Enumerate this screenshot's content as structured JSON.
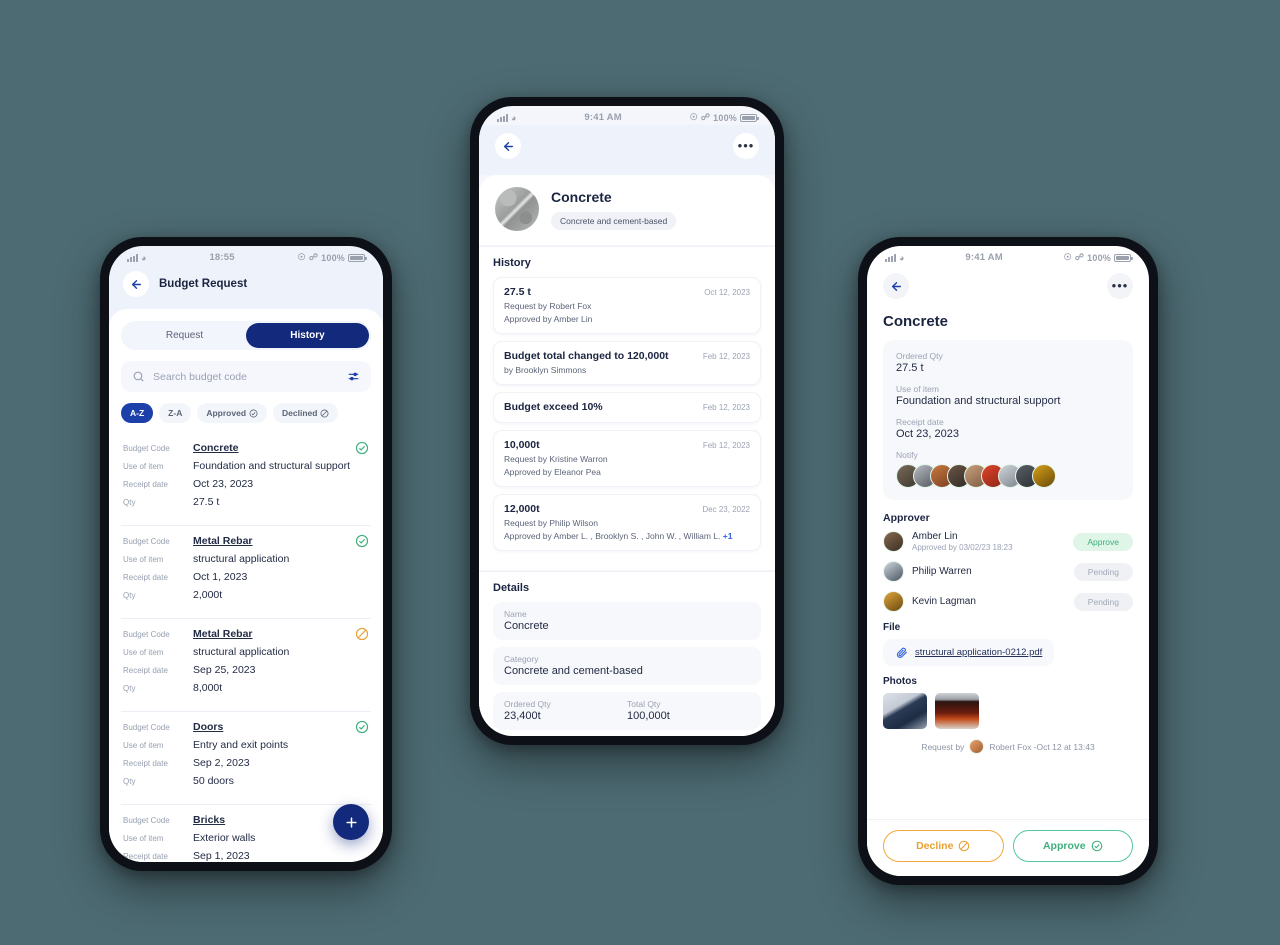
{
  "theme": {
    "background": "#4d6b73",
    "navy": "#12297c",
    "blue": "#1c3faa",
    "green": "#3fae7c",
    "orange": "#e8a033"
  },
  "left_phone": {
    "status": {
      "time": "18:55",
      "battery": "100%"
    },
    "header": {
      "title": "Budget Request",
      "back_icon": "arrow-left-icon"
    },
    "tabs": [
      {
        "label": "Request",
        "active": false
      },
      {
        "label": "History",
        "active": true
      }
    ],
    "search": {
      "placeholder": "Search budget code",
      "value": "",
      "icon": "search-icon",
      "filter_icon": "filter-icon"
    },
    "chips": [
      {
        "label": "A-Z",
        "active": true,
        "icon": ""
      },
      {
        "label": "Z-A",
        "active": false,
        "icon": ""
      },
      {
        "label": "Approved",
        "active": false,
        "icon": "check-circle-icon"
      },
      {
        "label": "Declined",
        "active": false,
        "icon": "ban-circle-icon"
      }
    ],
    "field_labels": {
      "code": "Budget Code",
      "use": "Use of item",
      "receipt": "Receipt date",
      "qty": "Qty"
    },
    "records": [
      {
        "code": "Concrete",
        "use": "Foundation and structural support",
        "receipt": "Oct 23, 2023",
        "qty": "27.5 t",
        "status": "approved"
      },
      {
        "code": "Metal Rebar",
        "use": "structural application",
        "receipt": "Oct 1, 2023",
        "qty": "2,000t",
        "status": "approved"
      },
      {
        "code": "Metal Rebar",
        "use": "structural application",
        "receipt": "Sep 25, 2023",
        "qty": "8,000t",
        "status": "declined"
      },
      {
        "code": "Doors",
        "use": "Entry and exit points",
        "receipt": "Sep 2, 2023",
        "qty": "50 doors",
        "status": "approved"
      },
      {
        "code": "Bricks",
        "use": "Exterior walls",
        "receipt": "Sep 1, 2023",
        "qty": "",
        "status": "approved"
      }
    ],
    "fab": {
      "label": "+",
      "icon": "plus-icon"
    }
  },
  "center_phone": {
    "status": {
      "time": "9:41 AM",
      "battery": "100%"
    },
    "topbar": {
      "back_icon": "arrow-left-icon",
      "menu_icon": "more-horizontal-icon"
    },
    "hero": {
      "name": "Concrete",
      "tag": "Concrete and cement-based",
      "thumb_icon": "concrete-thumbnail"
    },
    "history": {
      "title": "History",
      "items": [
        {
          "title": "27.5 t",
          "date": "Oct 12, 2023",
          "line1": "Request by Robert Fox",
          "line2": "Approved by Amber Lin",
          "more": ""
        },
        {
          "title": "Budget total changed to 120,000t",
          "date": "Feb 12, 2023",
          "line1": "by Brooklyn Simmons",
          "line2": "",
          "more": ""
        },
        {
          "title": "Budget exceed 10%",
          "date": "Feb 12, 2023",
          "line1": "",
          "line2": "",
          "more": ""
        },
        {
          "title": "10,000t",
          "date": "Feb 12, 2023",
          "line1": "Request by Kristine Warron",
          "line2": "Approved by Eleanor Pea",
          "more": ""
        },
        {
          "title": "12,000t",
          "date": "Dec 23, 2022",
          "line1": "Request by Philip Wilson",
          "line2": "Approved by Amber L. , Brooklyn S. , John W. , William L.",
          "more": "+1"
        }
      ]
    },
    "details": {
      "title": "Details",
      "name_label": "Name",
      "name_value": "Concrete",
      "category_label": "Category",
      "category_value": "Concrete and cement-based",
      "ordered_label": "Ordered Qty",
      "ordered_value": "23,400t",
      "total_label": "Total Qty",
      "total_value": "100,000t"
    }
  },
  "right_phone": {
    "status": {
      "time": "9:41 AM",
      "battery": "100%"
    },
    "topbar": {
      "back_icon": "arrow-left-icon",
      "menu_icon": "more-horizontal-icon"
    },
    "title": "Concrete",
    "summary": {
      "ordered_label": "Ordered Qty",
      "ordered_value": "27.5 t",
      "use_label": "Use of item",
      "use_value": "Foundation and structural support",
      "receipt_label": "Receipt date",
      "receipt_value": "Oct 23, 2023",
      "notify_label": "Notify",
      "notify_count": 9
    },
    "approver": {
      "title": "Approver",
      "rows": [
        {
          "name": "Amber Lin",
          "sub": "Approved by 03/02/23 18:23",
          "status": "Approve",
          "state": "approved"
        },
        {
          "name": "Philip Warren",
          "sub": "",
          "status": "Pending",
          "state": "pending"
        },
        {
          "name": "Kevin Lagman",
          "sub": "",
          "status": "Pending",
          "state": "pending"
        }
      ]
    },
    "file": {
      "label": "File",
      "name": "structural application-0212.pdf",
      "icon": "paperclip-icon"
    },
    "photos": {
      "label": "Photos",
      "count": 2
    },
    "request_by": "Request by",
    "request_name": "Robert Fox -Oct 12 at 13:43",
    "actions": {
      "decline": "Decline",
      "decline_icon": "ban-circle-icon",
      "approve": "Approve",
      "approve_icon": "check-circle-icon"
    }
  }
}
